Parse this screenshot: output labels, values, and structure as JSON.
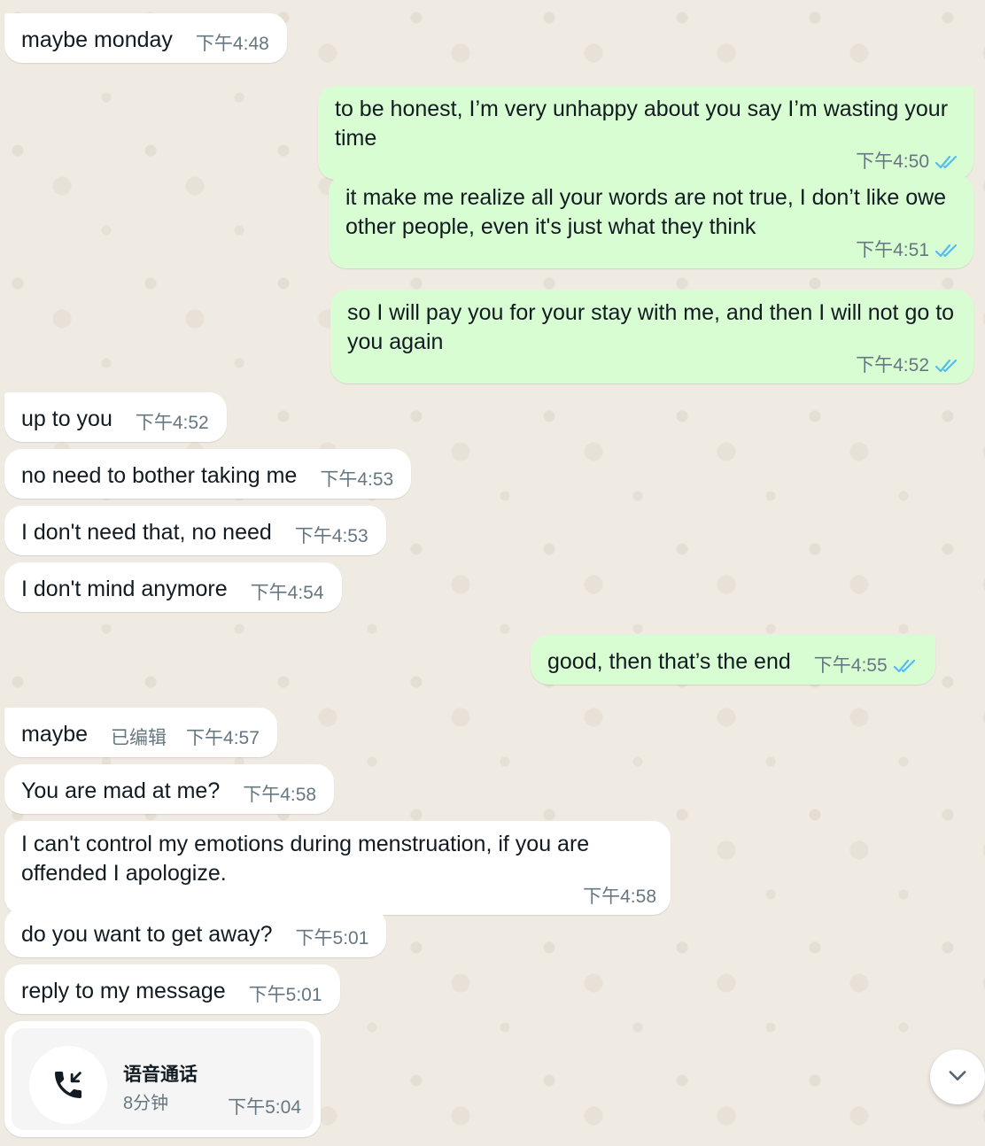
{
  "colors": {
    "incoming_bubble": "#ffffff",
    "outgoing_bubble": "#d9fdd3",
    "read_ticks": "#53bdeb",
    "meta_text": "#667781",
    "background": "#efeae2"
  },
  "messages": [
    {
      "text": "maybe monday",
      "time": "下午4:48",
      "dir": "in"
    },
    {
      "text": "to be honest, I’m very unhappy about you say I’m wasting your time",
      "time": "下午4:50",
      "dir": "out",
      "status": "read"
    },
    {
      "text": "it make me realize all your words are not true, I don’t like owe other people, even it's just what they think",
      "time": "下午4:51",
      "dir": "out",
      "status": "read"
    },
    {
      "text": "so I will pay you for your stay with me, and then I will not go to you again",
      "time": "下午4:52",
      "dir": "out",
      "status": "read"
    },
    {
      "text": "up to you",
      "time": "下午4:52",
      "dir": "in"
    },
    {
      "text": "no need to bother taking me",
      "time": "下午4:53",
      "dir": "in"
    },
    {
      "text": "I don't need that, no need",
      "time": "下午4:53",
      "dir": "in"
    },
    {
      "text": "I don't mind anymore",
      "time": "下午4:54",
      "dir": "in"
    },
    {
      "text": "good, then that’s the end",
      "time": "下午4:55",
      "dir": "out",
      "status": "read"
    },
    {
      "text": "maybe",
      "edited": "已编辑",
      "time": "下午4:57",
      "dir": "in"
    },
    {
      "text": "You are mad at me?",
      "time": "下午4:58",
      "dir": "in"
    },
    {
      "text": "I can't control my emotions during menstruation, if you are offended I apologize.",
      "time": "下午4:58",
      "dir": "in"
    },
    {
      "text": "do you want to get away?",
      "time": "下午5:01",
      "dir": "in"
    },
    {
      "text": "reply to my message",
      "time": "下午5:01",
      "dir": "in"
    }
  ],
  "call": {
    "icon": "incoming-call-icon",
    "title": "语音通话",
    "duration": "8分钟",
    "time": "下午5:04"
  },
  "scroll_button": {
    "icon": "chevron-down-icon"
  }
}
